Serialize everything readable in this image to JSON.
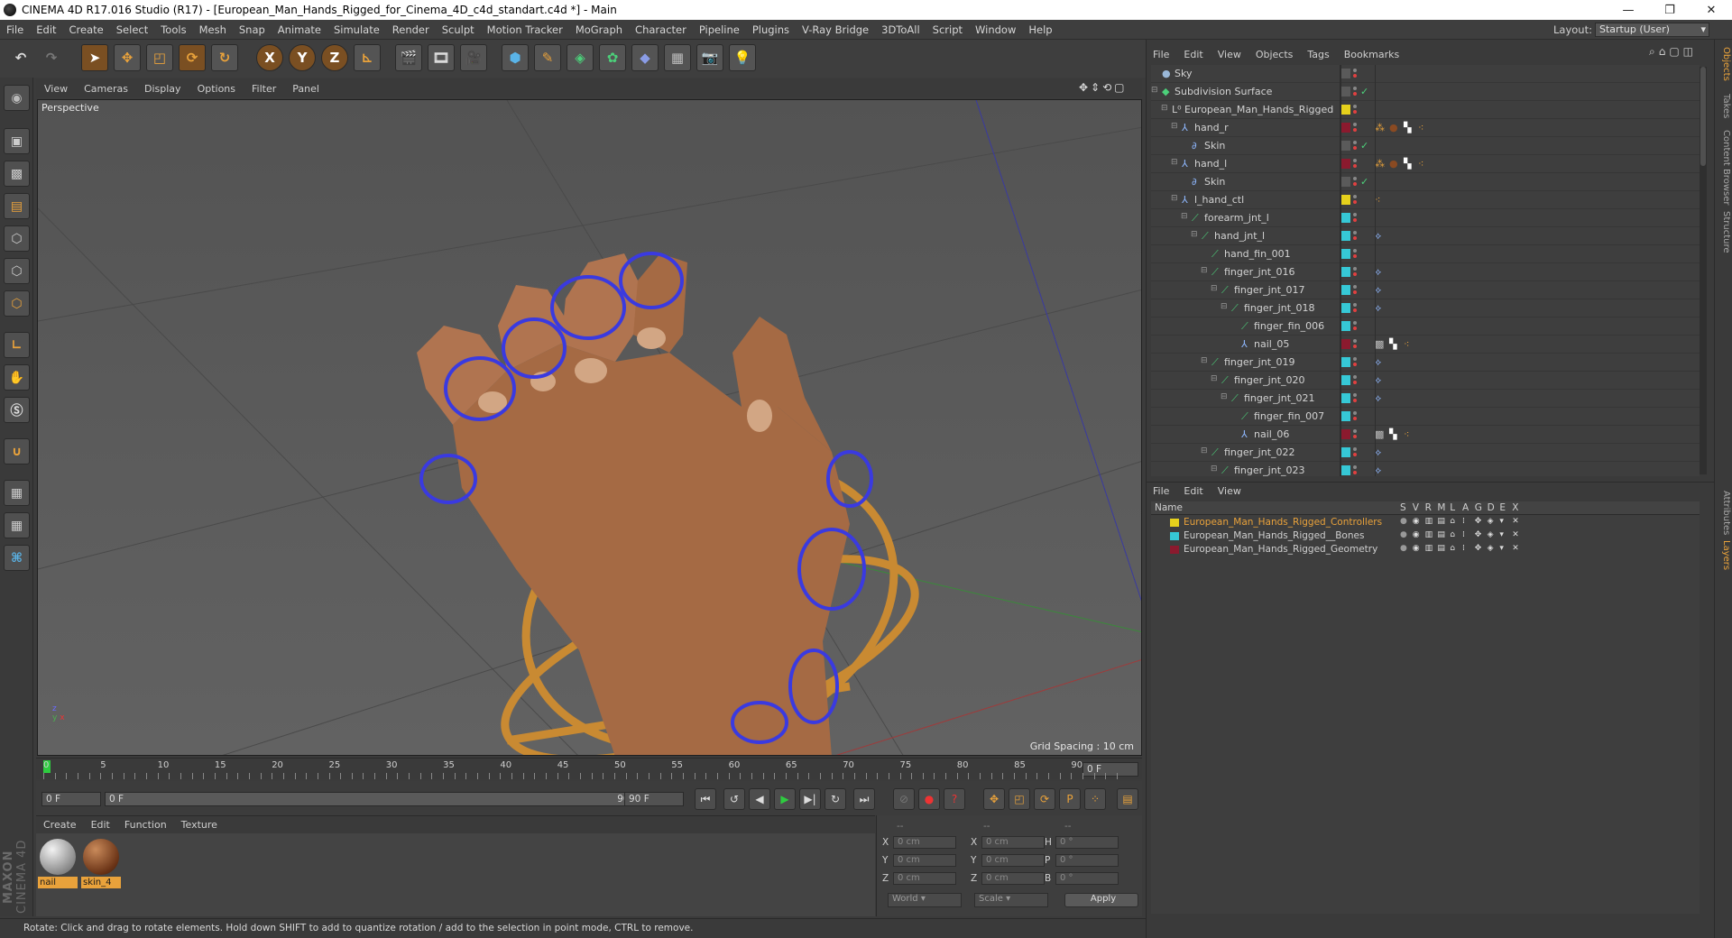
{
  "app": {
    "title": "CINEMA 4D R17.016 Studio (R17) - [European_Man_Hands_Rigged_for_Cinema_4D_c4d_standart.c4d *] - Main",
    "window_controls": {
      "minimize": "—",
      "maximize": "❐",
      "close": "✕"
    }
  },
  "menubar": [
    "File",
    "Edit",
    "Create",
    "Select",
    "Tools",
    "Mesh",
    "Snap",
    "Animate",
    "Simulate",
    "Render",
    "Sculpt",
    "Motion Tracker",
    "MoGraph",
    "Character",
    "Pipeline",
    "Plugins",
    "V-Ray Bridge",
    "3DToAll",
    "Script",
    "Window",
    "Help"
  ],
  "layout": {
    "label": "Layout:",
    "value": "Startup (User)"
  },
  "toolbar": {
    "axis_x": "X",
    "axis_y": "Y",
    "axis_z": "Z"
  },
  "viewport": {
    "menu": [
      "View",
      "Cameras",
      "Display",
      "Options",
      "Filter",
      "Panel"
    ],
    "label": "Perspective",
    "grid_spacing": "Grid Spacing : 10 cm"
  },
  "timeline": {
    "ticks": [
      "0",
      "5",
      "10",
      "15",
      "20",
      "25",
      "30",
      "35",
      "40",
      "45",
      "50",
      "55",
      "60",
      "65",
      "70",
      "75",
      "80",
      "85",
      "90"
    ],
    "current_frame": "0 F"
  },
  "transport": {
    "start": "0 F",
    "range_left": "0 F",
    "range_right": "90 F",
    "end": "90 F"
  },
  "materials": {
    "menu": [
      "Create",
      "Edit",
      "Function",
      "Texture"
    ],
    "items": [
      {
        "name": "nail",
        "color": "#b9b9b9"
      },
      {
        "name": "skin_4",
        "color": "#8a4a22"
      }
    ]
  },
  "attributes": {
    "headers": [
      "--",
      "--",
      "--"
    ],
    "rows": [
      {
        "a": "X",
        "av": "0 cm",
        "b": "X",
        "bv": "0 cm",
        "c": "H",
        "cv": "0 °"
      },
      {
        "a": "Y",
        "av": "0 cm",
        "b": "Y",
        "bv": "0 cm",
        "c": "P",
        "cv": "0 °"
      },
      {
        "a": "Z",
        "av": "0 cm",
        "b": "Z",
        "bv": "0 cm",
        "c": "B",
        "cv": "0 °"
      }
    ],
    "coord_mode": "World",
    "size_mode": "Scale",
    "apply": "Apply"
  },
  "status": "Rotate: Click and drag to rotate elements. Hold down SHIFT to add to quantize rotation / add to the selection in point mode, CTRL to remove.",
  "logo": {
    "line1": "MAXON",
    "line2": "CINEMA 4D"
  },
  "objects": {
    "menu": [
      "File",
      "Edit",
      "View",
      "Objects",
      "Tags",
      "Bookmarks"
    ],
    "rows": [
      {
        "name": "Sky",
        "indent": 0,
        "color": "#5a5a5a",
        "icon": "sky"
      },
      {
        "name": "Subdivision Surface",
        "indent": 0,
        "color": "#5a5a5a",
        "icon": "subdiv"
      },
      {
        "name": "European_Man_Hands_Rigged",
        "indent": 1,
        "color": "#e6d11c",
        "icon": "null"
      },
      {
        "name": "hand_r",
        "indent": 2,
        "color": "#8b1a2e",
        "icon": "joint"
      },
      {
        "name": "Skin",
        "indent": 3,
        "color": "#5a5a5a",
        "icon": "skin"
      },
      {
        "name": "hand_l",
        "indent": 2,
        "color": "#8b1a2e",
        "icon": "joint"
      },
      {
        "name": "Skin",
        "indent": 3,
        "color": "#5a5a5a",
        "icon": "skin"
      },
      {
        "name": "l_hand_ctl",
        "indent": 2,
        "color": "#e6d11c",
        "icon": "joint"
      },
      {
        "name": "forearm_jnt_l",
        "indent": 3,
        "color": "#36c8d6",
        "icon": "bone"
      },
      {
        "name": "hand_jnt_l",
        "indent": 4,
        "color": "#36c8d6",
        "icon": "bone"
      },
      {
        "name": "hand_fin_001",
        "indent": 5,
        "color": "#36c8d6",
        "icon": "bone"
      },
      {
        "name": "finger_jnt_016",
        "indent": 5,
        "color": "#36c8d6",
        "icon": "bone"
      },
      {
        "name": "finger_jnt_017",
        "indent": 6,
        "color": "#36c8d6",
        "icon": "bone"
      },
      {
        "name": "finger_jnt_018",
        "indent": 7,
        "color": "#36c8d6",
        "icon": "bone"
      },
      {
        "name": "finger_fin_006",
        "indent": 8,
        "color": "#36c8d6",
        "icon": "bone"
      },
      {
        "name": "nail_05",
        "indent": 8,
        "color": "#8b1a2e",
        "icon": "joint"
      },
      {
        "name": "finger_jnt_019",
        "indent": 5,
        "color": "#36c8d6",
        "icon": "bone"
      },
      {
        "name": "finger_jnt_020",
        "indent": 6,
        "color": "#36c8d6",
        "icon": "bone"
      },
      {
        "name": "finger_jnt_021",
        "indent": 7,
        "color": "#36c8d6",
        "icon": "bone"
      },
      {
        "name": "finger_fin_007",
        "indent": 8,
        "color": "#36c8d6",
        "icon": "bone"
      },
      {
        "name": "nail_06",
        "indent": 8,
        "color": "#8b1a2e",
        "icon": "joint"
      },
      {
        "name": "finger_jnt_022",
        "indent": 5,
        "color": "#36c8d6",
        "icon": "bone"
      },
      {
        "name": "finger_jnt_023",
        "indent": 6,
        "color": "#36c8d6",
        "icon": "bone"
      }
    ]
  },
  "layers": {
    "menu": [
      "File",
      "Edit",
      "View"
    ],
    "columns": [
      "Name",
      "S",
      "V",
      "R",
      "M",
      "L",
      "A",
      "G",
      "D",
      "E",
      "X"
    ],
    "rows": [
      {
        "name": "European_Man_Hands_Rigged_Controllers",
        "color": "#e6d11c",
        "text_color": "#e9a23b"
      },
      {
        "name": "European_Man_Hands_Rigged__Bones",
        "color": "#36c8d6",
        "text_color": "#cfcfcf"
      },
      {
        "name": "European_Man_Hands_Rigged_Geometry",
        "color": "#8b1a2e",
        "text_color": "#cfcfcf"
      }
    ]
  },
  "side_tabs": [
    "Objects",
    "Takes",
    "Content Browser",
    "Structure",
    "Attributes",
    "Layers"
  ]
}
